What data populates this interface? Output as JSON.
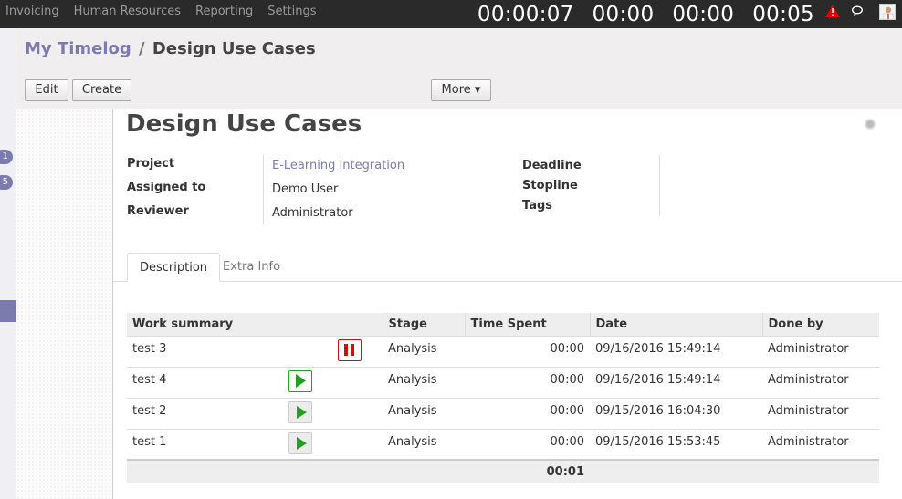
{
  "topbar": {
    "menu": [
      "Invoicing",
      "Human Resources",
      "Reporting",
      "Settings"
    ],
    "timers": [
      "00:00:07",
      "00:00",
      "00:00",
      "00:05"
    ],
    "warn_color": "#e00000"
  },
  "rail": {
    "badge1": "1",
    "badge2": "5"
  },
  "breadcrumb": {
    "parent": "My Timelog",
    "separator": "/",
    "current": "Design Use Cases"
  },
  "buttons": {
    "edit": "Edit",
    "create": "Create",
    "more": "More ▾"
  },
  "record": {
    "title": "Design Use Cases",
    "fields_left": [
      {
        "label": "Project",
        "value": "E-Learning Integration"
      },
      {
        "label": "Assigned to",
        "value": "Demo User"
      },
      {
        "label": "Reviewer",
        "value": "Administrator"
      }
    ],
    "fields_right": [
      "Deadline",
      "Stopline",
      "Tags"
    ]
  },
  "tabs": [
    "Description",
    "Extra Info"
  ],
  "table": {
    "headers": [
      "Work summary",
      "Stage",
      "Time Spent",
      "Date",
      "Done by"
    ],
    "rows": [
      {
        "summary": "test 3",
        "stage": "Analysis",
        "time": "00:00",
        "date": "09/16/2016 15:49:14",
        "by": "Administrator",
        "control": "pause"
      },
      {
        "summary": "test 4",
        "stage": "Analysis",
        "time": "00:00",
        "date": "09/16/2016 15:49:14",
        "by": "Administrator",
        "control": "play-active"
      },
      {
        "summary": "test 2",
        "stage": "Analysis",
        "time": "00:00",
        "date": "09/15/2016 16:04:30",
        "by": "Administrator",
        "control": "play"
      },
      {
        "summary": "test 1",
        "stage": "Analysis",
        "time": "00:00",
        "date": "09/15/2016 15:53:45",
        "by": "Administrator",
        "control": "play"
      }
    ],
    "total": "00:01"
  },
  "colors": {
    "accent": "#7c7bad",
    "play_green": "#1fa01f",
    "pause_red": "#cc1111"
  }
}
